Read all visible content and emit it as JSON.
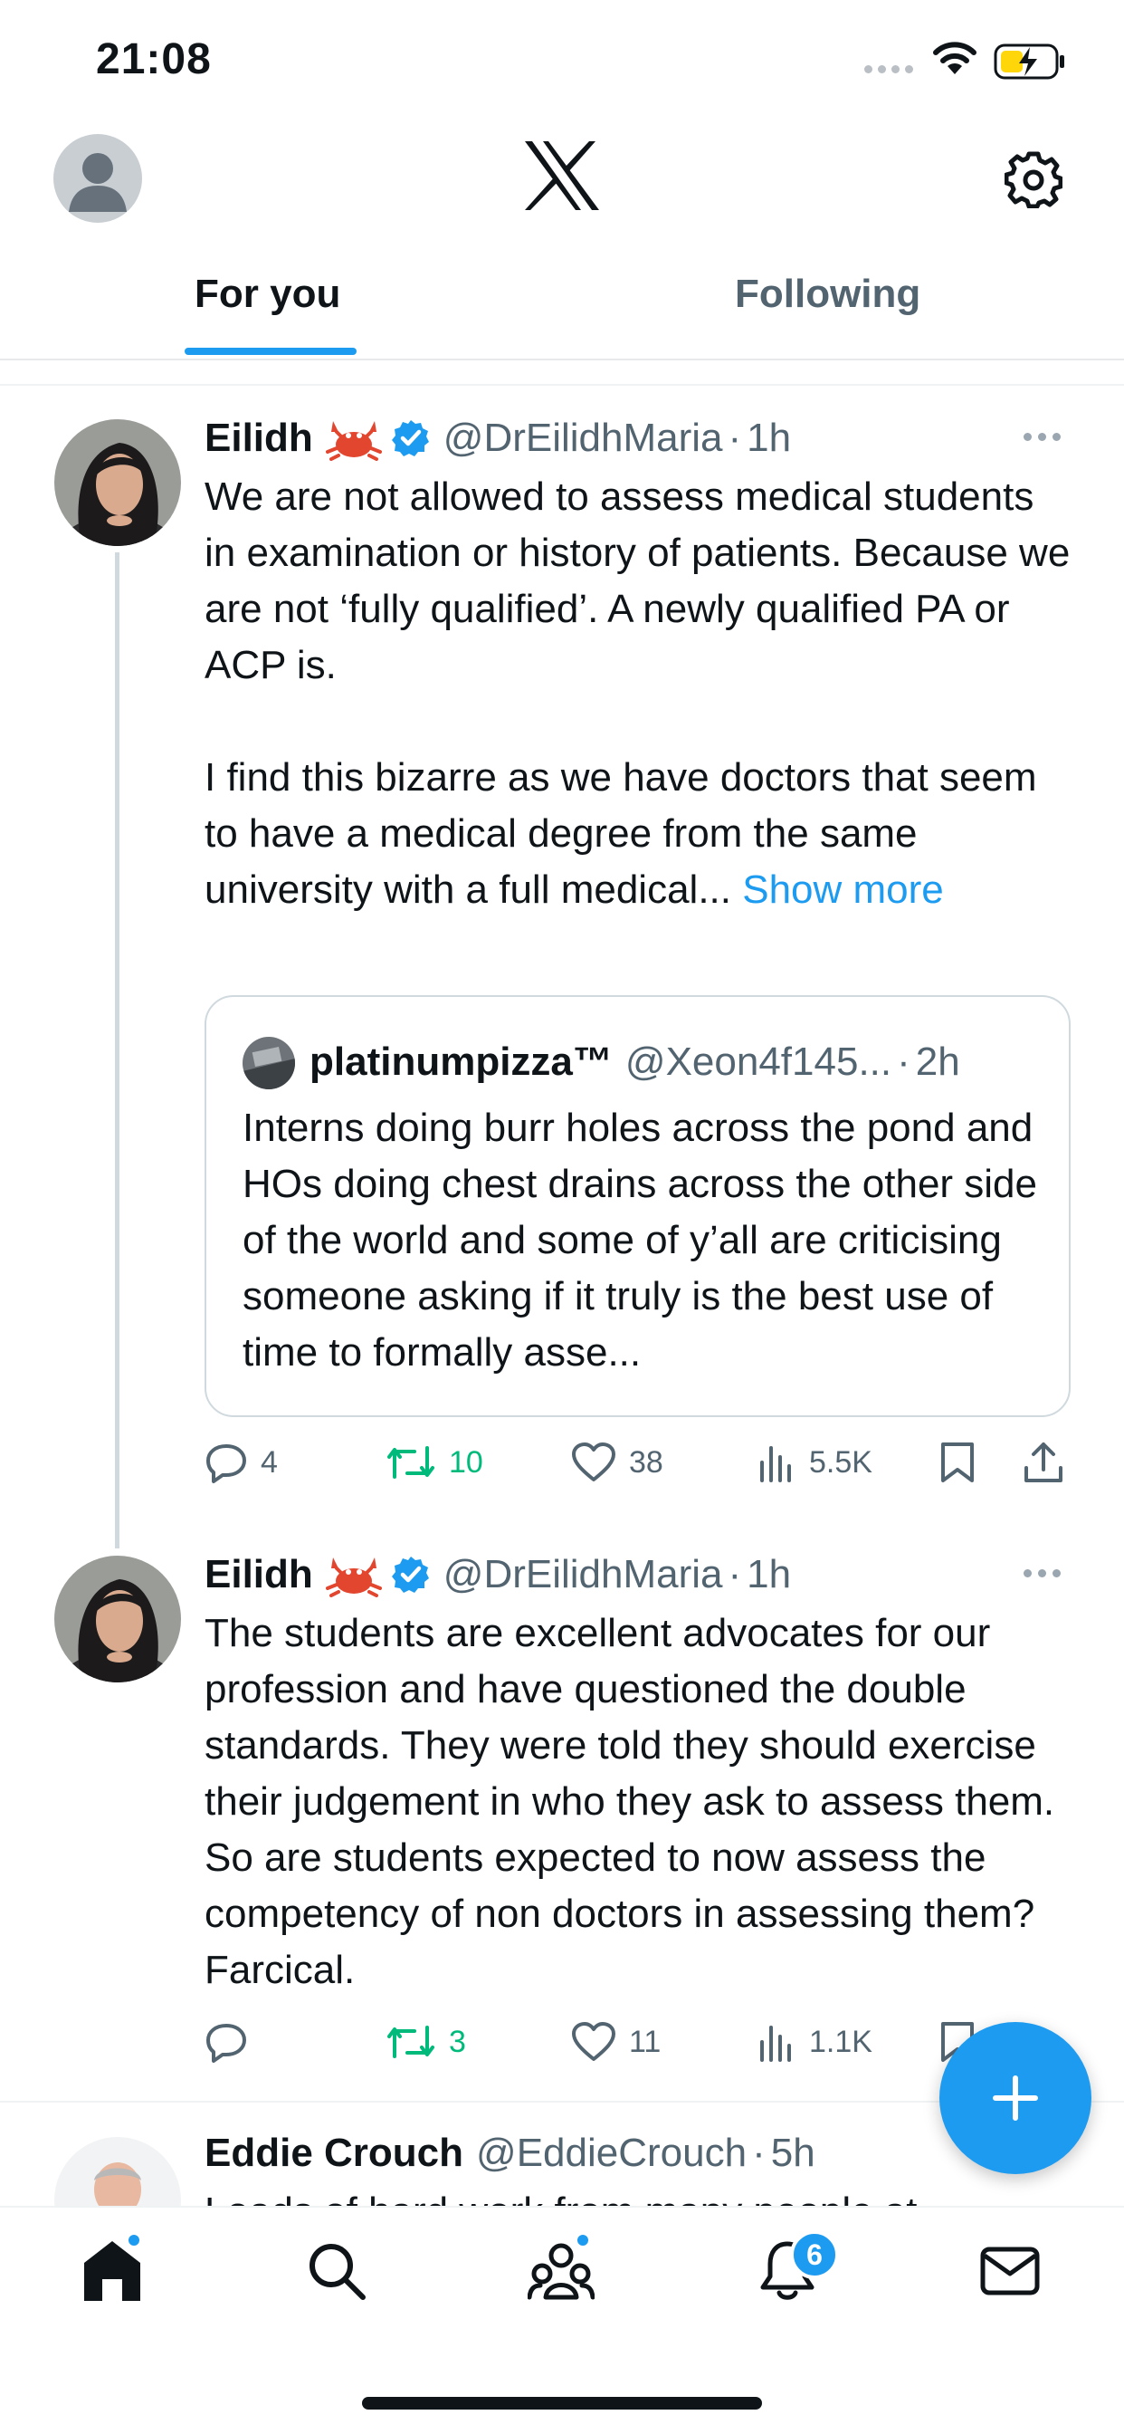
{
  "status_bar": {
    "time": "21:08"
  },
  "header": {
    "logo": "x-logo",
    "tabs": [
      {
        "label": "For you",
        "active": true
      },
      {
        "label": "Following",
        "active": false
      }
    ]
  },
  "tweets": [
    {
      "name": "Eilidh",
      "emoji": "crab",
      "verified": true,
      "handle": "@DrEilidhMaria",
      "time": "1h",
      "text": "We are not allowed to assess medical students in examination or history of patients. Because we are not ‘fully qualified’. A newly qualified PA or ACP is.\n\nI find this bizarre as we have doctors that seem to have a medical degree from the same university with a full medical...",
      "show_more": "Show more",
      "quote": {
        "name": "platinumpizza™",
        "handle": "@Xeon4f145...",
        "time": "2h",
        "text": "Interns doing burr holes across the pond and HOs doing chest drains across the other side of the world and some of y’all are criticising someone asking if it truly is the best use of time to formally asse..."
      },
      "stats": {
        "replies": "4",
        "reposts": "10",
        "likes": "38",
        "views": "5.5K"
      }
    },
    {
      "name": "Eilidh",
      "emoji": "crab",
      "verified": true,
      "handle": "@DrEilidhMaria",
      "time": "1h",
      "text": "The students are excellent advocates for our profession and have questioned the double standards. They were told they should exercise their judgement in who they ask to assess them. So are students expected to now assess the competency of non doctors in assessing them? Farcical.",
      "stats": {
        "replies": "",
        "reposts": "3",
        "likes": "11",
        "views": "1.1K"
      }
    },
    {
      "name": "Eddie Crouch",
      "handle": "@EddieCrouch",
      "time": "5h",
      "text_partial": "Loads of hard work from many people at"
    }
  ],
  "bottom_nav": {
    "items": [
      "home-icon",
      "search-icon",
      "communities-icon",
      "notifications-icon",
      "messages-icon"
    ],
    "notification_badge": "6"
  },
  "colors": {
    "accent": "#1d9bf0",
    "repost_green": "#00ba7c",
    "text_primary": "#0f1419",
    "text_secondary": "#536471"
  }
}
